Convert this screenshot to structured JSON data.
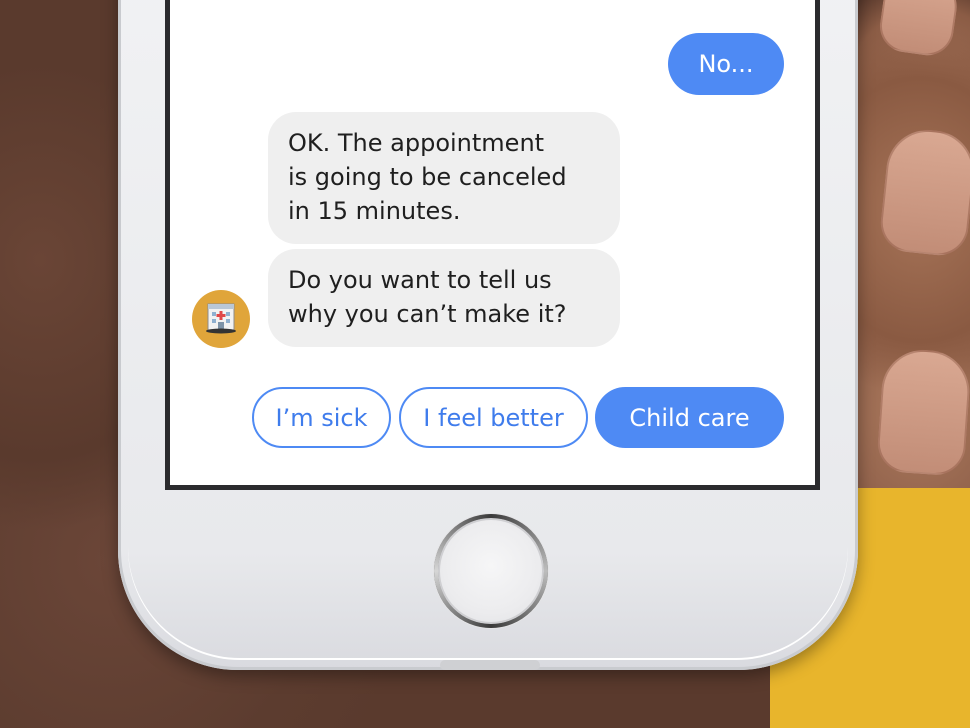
{
  "colors": {
    "accent": "#4e8af4",
    "incoming_bubble": "#efefef",
    "avatar_bg": "#e0a53a",
    "background_yellow": "#e8b52c"
  },
  "chat": {
    "outgoing_message": "No...",
    "incoming_messages": [
      "OK. The appointment\nis going to be canceled\nin 15 minutes.",
      "Do you want to tell us\nwhy you can’t make it?"
    ],
    "avatar_icon": "hospital-icon"
  },
  "quick_replies": [
    "I’m sick",
    "I feel better",
    "Child care"
  ]
}
